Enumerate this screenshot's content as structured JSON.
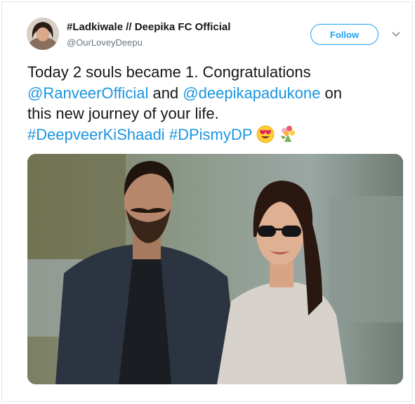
{
  "tweet": {
    "display_name": "#Ladkiwale // Deepika FC Official",
    "handle": "@OurLoveyDeepu",
    "follow_label": "Follow",
    "text_line1": "Today 2 souls became 1. Congratulations",
    "mention1": "@RanveerOfficial",
    "and_text": "and",
    "mention2": "@deepikapadukone",
    "on_text": "on",
    "text_line3": "this new journey of your life.",
    "hashtag1": "#DeepveerKiShaadi",
    "hashtag2": "#DPismyDP"
  },
  "icons": {
    "caret": "chevron-down-icon",
    "emoji1": "heart-eyes-emoji",
    "emoji2": "bouquet-emoji"
  },
  "colors": {
    "link": "#1b95e0",
    "follow": "#1da1f2",
    "text": "#14171a",
    "muted": "#657786"
  }
}
